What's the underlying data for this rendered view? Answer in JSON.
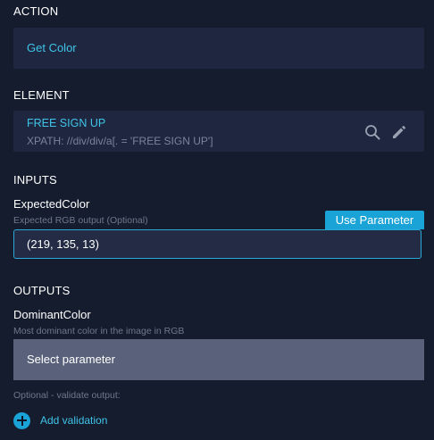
{
  "action": {
    "section_title": "ACTION",
    "value": "Get Color"
  },
  "element": {
    "section_title": "ELEMENT",
    "name": "FREE SIGN UP",
    "xpath": "XPATH: //div/div/a[. = 'FREE SIGN UP']",
    "icons": [
      "search-icon",
      "pencil-icon"
    ]
  },
  "inputs": {
    "section_title": "INPUTS",
    "field_name": "ExpectedColor",
    "field_desc": "Expected RGB output (Optional)",
    "use_parameter_label": "Use Parameter",
    "value": "(219, 135, 13)"
  },
  "outputs": {
    "section_title": "OUTPUTS",
    "field_name": "DominantColor",
    "field_desc": "Most dominant color in the image in RGB",
    "select_label": "Select parameter",
    "optional_text": "Optional - validate output:",
    "add_validation_label": "Add validation"
  },
  "colors": {
    "background": "#151c2e",
    "card": "#1f2740",
    "accent": "#1aa3d6",
    "accent_text": "#3fc4e8",
    "select_bg": "#59627a"
  }
}
